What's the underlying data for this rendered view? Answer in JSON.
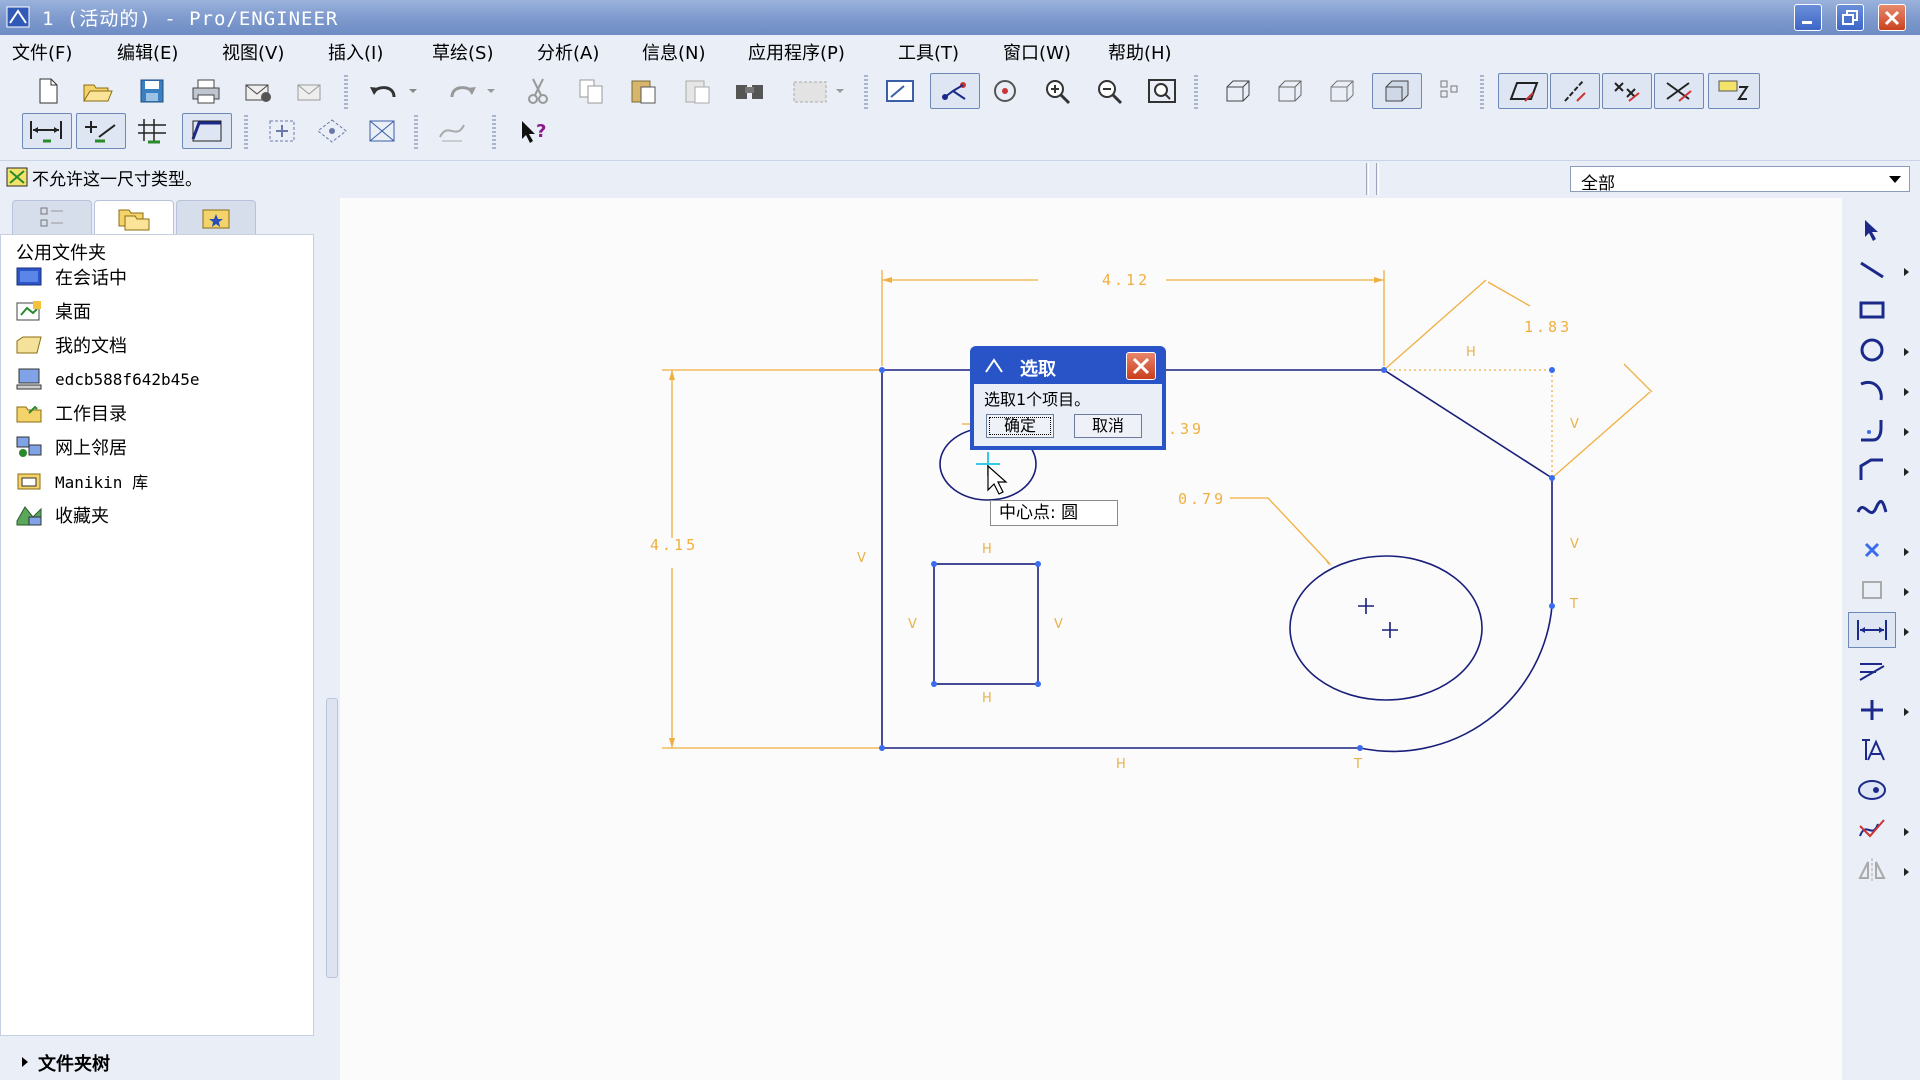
{
  "window": {
    "title": "1 (活动的) - Pro/ENGINEER"
  },
  "menu": [
    "文件(F)",
    "编辑(E)",
    "视图(V)",
    "插入(I)",
    "草绘(S)",
    "分析(A)",
    "信息(N)",
    "应用程序(P)",
    "工具(T)",
    "窗口(W)",
    "帮助(H)"
  ],
  "message": {
    "text": "不允许这一尺寸类型。"
  },
  "filter": {
    "value": "全部"
  },
  "left_panel": {
    "header": "公用文件夹",
    "items": [
      {
        "label": "在会话中",
        "icon": "session-icon"
      },
      {
        "label": "桌面",
        "icon": "desktop-icon"
      },
      {
        "label": "我的文档",
        "icon": "my-documents-icon"
      },
      {
        "label": "edcb588f642b45e",
        "icon": "computer-icon"
      },
      {
        "label": "工作目录",
        "icon": "working-directory-icon"
      },
      {
        "label": "网上邻居",
        "icon": "network-icon"
      },
      {
        "label": "Manikin 库",
        "icon": "manikin-library-icon"
      },
      {
        "label": "收藏夹",
        "icon": "favorites-icon"
      }
    ],
    "footer": "文件夹树"
  },
  "drawing": {
    "dims": {
      "width": "4.12",
      "height": "4.15",
      "diag": "1.83",
      "radius": "0.79",
      "partial": ".39"
    },
    "constraints": {
      "h": "H",
      "v": "V",
      "t": "T"
    }
  },
  "dialog": {
    "title": "选取",
    "message": "选取1个项目。",
    "ok": "确定",
    "cancel": "取消"
  },
  "tooltip": {
    "text": "中心点: 圆"
  },
  "colors": {
    "geometry": "#1a1f7a",
    "dimension": "#f0b040",
    "vertex": "#3a6cf0",
    "titlebar": "#7f9bce"
  }
}
